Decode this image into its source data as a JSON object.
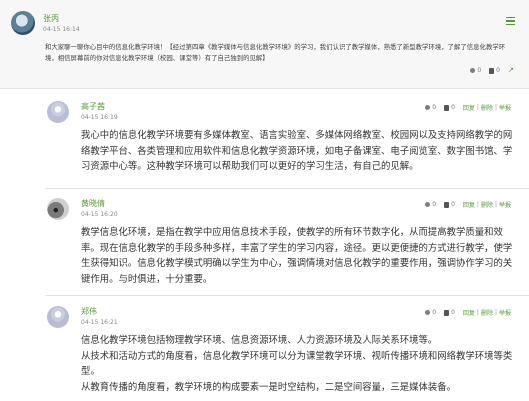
{
  "post": {
    "author": "张丙",
    "time": "04-15 16:14",
    "text": "和大家聊一聊你心目中的信息化教学环境！【经过第四章《教学媒体与信息化教学环境》的学习，我们认识了教学媒体，熟悉了新型教学环境，了解了信息化教学环境，相信屏幕前的你对信息化教学环境（校园、课堂等）有了自己独到的见解】",
    "flowers": "0",
    "likes": "0",
    "menu_icon": "hamburger-menu-icon",
    "share_icon": "share-icon"
  },
  "replies": [
    {
      "author": "高子茜",
      "time": "04-15 16:19",
      "text": "我心中的信息化教学环境要有多媒体教室、语言实验室、多媒体网络教室、校园网以及支持网络教学的网络教学平台、各类管理和应用软件和信息化教学资源环境，如电子备课室、电子阅览室、数字图书馆、学习资源中心等。这种教学环境可以帮助我们可以更好的学习生活，有自己的见解。",
      "flowers": "0",
      "likes": "0",
      "reply": "回复",
      "delete": "删除",
      "report": "举报"
    },
    {
      "author": "黄晓倩",
      "time": "04-15 16:20",
      "text": "教学信息化环境，是指在教学中应用信息技术手段，使教学的所有环节数字化，从而提高教学质量和效率。现在信息化教学的手段多种多样，丰富了学生的学习内容，途径。更以更便捷的方式进行教学，使学生获得知识。信息化教学模式明确以学生为中心，强调情境对信息化教学的重要作用，强调协作学习的关键作用。与时俱进，十分重要。",
      "flowers": "0",
      "likes": "0",
      "reply": "回复",
      "delete": "删除",
      "report": "举报"
    },
    {
      "author": "郑伟",
      "time": "04-15 16:21",
      "text": "信息化教学环境包括物理教学环境、信息资源环境、人力资源环境及人际关系环境等。\n从技术和活动方式的角度看，信息化教学环境可以分为课堂教学环境、视听传播环境和网络教学环境等类型。\n从教育传播的角度看，教学环境的构成要素一是时空结构，二是空间容量，三是媒体装备。",
      "flowers": "0",
      "likes": "0",
      "reply": "回复",
      "delete": "删除",
      "report": "举报"
    }
  ]
}
